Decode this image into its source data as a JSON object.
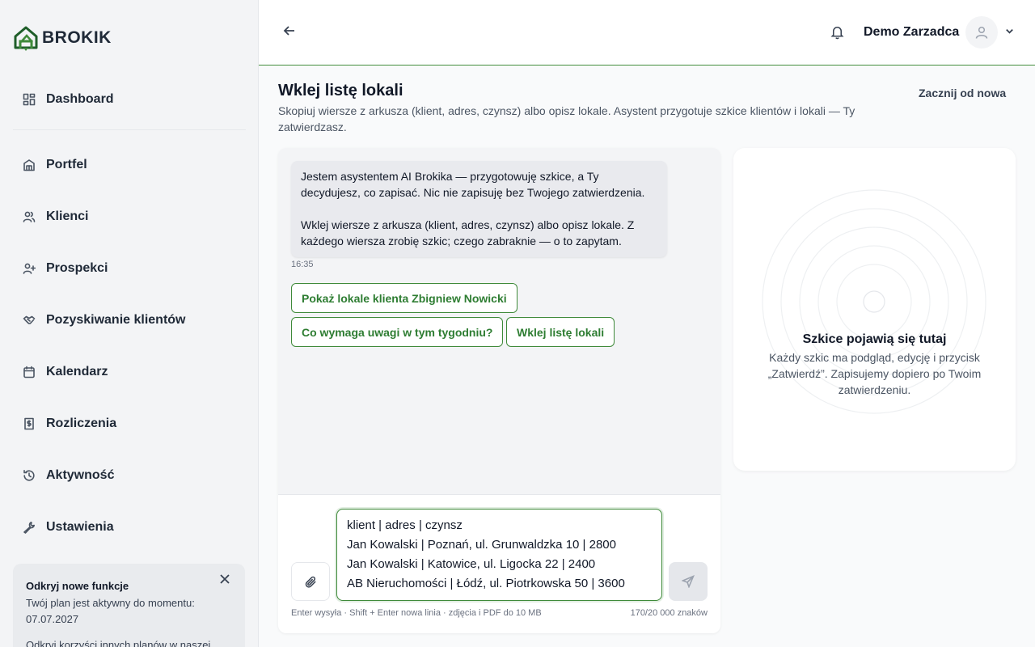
{
  "brand": {
    "name": "BROKIK",
    "accent": "#3f8a3a"
  },
  "sidebar": {
    "items": [
      {
        "label": "Dashboard",
        "icon": "dashboard-icon"
      },
      {
        "label": "Portfel",
        "icon": "building-icon"
      },
      {
        "label": "Klienci",
        "icon": "users-icon"
      },
      {
        "label": "Prospekci",
        "icon": "user-plus-icon"
      },
      {
        "label": "Pozyskiwanie klientów",
        "icon": "handshake-icon"
      },
      {
        "label": "Kalendarz",
        "icon": "calendar-icon"
      },
      {
        "label": "Rozliczenia",
        "icon": "invoice-icon"
      },
      {
        "label": "Aktywność",
        "icon": "history-icon"
      },
      {
        "label": "Ustawienia",
        "icon": "wrench-icon"
      }
    ],
    "promo": {
      "title": "Odkryj nowe funkcje",
      "text": "Twój plan jest aktywny do momentu: 07.07.2027",
      "text2": "Odkryj korzyści innych planów w naszej"
    }
  },
  "header": {
    "user_name": "Demo Zarzadca"
  },
  "page": {
    "title": "Wklej listę lokali",
    "subtitle": "Skopiuj wiersze z arkusza (klient, adres, czynsz) albo opisz lokale. Asystent przygotuje szkice klientów i lokali — Ty zatwierdzasz.",
    "restart_label": "Zacznij od nowa"
  },
  "chat": {
    "message_p1": "Jestem asystentem AI Brokika — przygotowuję szkice, a Ty decydujesz, co zapisać. Nic nie zapisuję bez Twojego zatwierdzenia.",
    "message_p2": "Wklej wiersze z arkusza (klient, adres, czynsz) albo opisz lokale. Z każdego wiersza zrobię szkic; czego zabraknie — o to zapytam.",
    "time": "16:35",
    "suggestions": [
      "Pokaż lokale klienta Zbigniew Nowicki",
      "Co wymaga uwagi w tym tygodniu?",
      "Wklej listę lokali"
    ],
    "input_value": "klient | adres | czynsz\nJan Kowalski | Poznań, ul. Grunwaldzka 10 | 2800\nJan Kowalski | Katowice, ul. Ligocka 22 | 2400\nAB Nieruchomości | Łódź, ul. Piotrkowska 50 | 3600",
    "hint": "Enter wysyła · Shift + Enter nowa linia · zdjęcia i PDF do 10 MB",
    "counter": "170/20 000 znaków"
  },
  "drafts": {
    "title": "Szkice pojawią się tutaj",
    "text": "Każdy szkic ma podgląd, edycję i przycisk „Zatwierdź”. Zapisujemy dopiero po Twoim zatwierdzeniu."
  }
}
